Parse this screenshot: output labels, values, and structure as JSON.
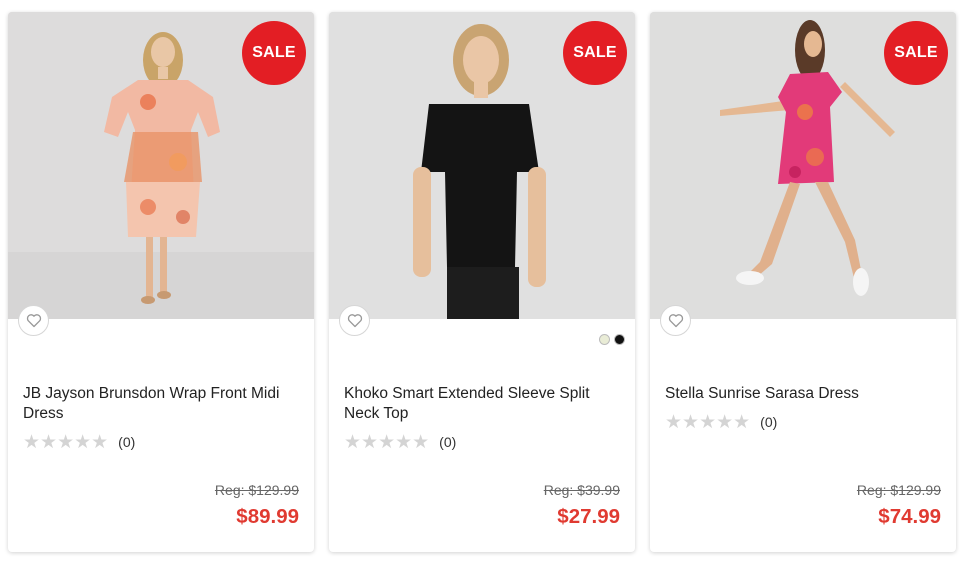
{
  "products": [
    {
      "badge": "SALE",
      "title": "JB Jayson Brunsdon Wrap Front Midi Dress",
      "stars": "★★★★★",
      "review_count": "(0)",
      "rating_value": 0,
      "reg_price": "Reg: $129.99",
      "sale_price": "$89.99",
      "swatches": []
    },
    {
      "badge": "SALE",
      "title": "Khoko Smart Extended Sleeve Split Neck Top",
      "stars": "★★★★★",
      "review_count": "(0)",
      "rating_value": 0,
      "reg_price": "Reg: $39.99",
      "sale_price": "$27.99",
      "swatches": [
        "#e9ecd6",
        "#111111"
      ]
    },
    {
      "badge": "SALE",
      "title": "Stella Sunrise Sarasa Dress",
      "stars": "★★★★★",
      "review_count": "(0)",
      "rating_value": 0,
      "reg_price": "Reg: $129.99",
      "sale_price": "$74.99",
      "swatches": []
    }
  ],
  "colors": {
    "sale_badge": "#e31e24",
    "sale_price": "#e03a31",
    "star_empty": "#d4d4d4",
    "image_bg": "#dedede"
  },
  "icons": {
    "wishlist": "heart-outline-icon",
    "rating": "star-icon"
  }
}
